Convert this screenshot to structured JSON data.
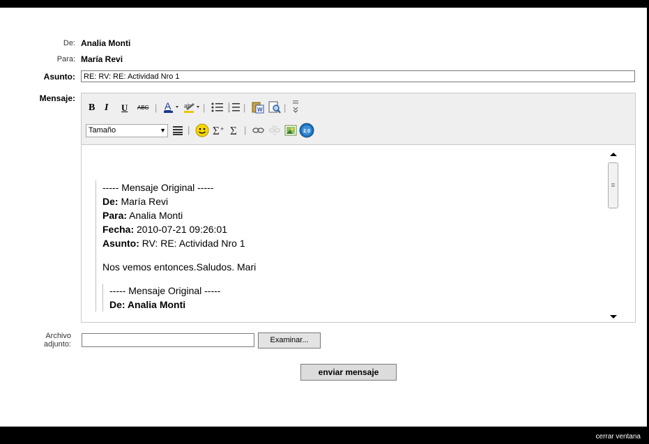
{
  "header": {
    "from_label": "De:",
    "from_value": "Analia Monti",
    "to_label": "Para:",
    "to_value": "María Revi",
    "subject_label": "Asunto:",
    "subject_value": "RE: RV: RE: Actividad Nro 1",
    "message_label": "Mensaje:"
  },
  "toolbar": {
    "bold": "B",
    "italic": "I",
    "underline": "U",
    "strike": "ABC",
    "size_select": "Tamaño",
    "version_badge": "2.0"
  },
  "message": {
    "sep": "----- Mensaje Original -----",
    "de_label": "De:",
    "de_value": "María Revi",
    "para_label": "Para:",
    "para_value": "Analia Monti",
    "fecha_label": "Fecha:",
    "fecha_value": "2010-07-21 09:26:01",
    "asunto_label": "Asunto:",
    "asunto_value": "RV: RE: Actividad Nro 1",
    "body": "Nos vemos entonces.Saludos. Mari",
    "nested_sep": "----- Mensaje Original -----",
    "nested_partial": "De: Analia Monti"
  },
  "attachment": {
    "label_line1": "Archivo",
    "label_line2": "adjunto:",
    "browse_label": "Examinar..."
  },
  "actions": {
    "send_label": "enviar mensaje"
  },
  "footer": {
    "close_label": "cerrar ventana"
  },
  "icons": [
    "font-color-icon",
    "highlight-icon",
    "bullet-list-icon",
    "numbered-list-icon",
    "paste-word-icon",
    "preview-icon",
    "more-icon",
    "align-icon",
    "smiley-icon",
    "sum-icon",
    "sigma-icon",
    "link-icon",
    "unlink-icon",
    "image-icon",
    "version-icon"
  ]
}
